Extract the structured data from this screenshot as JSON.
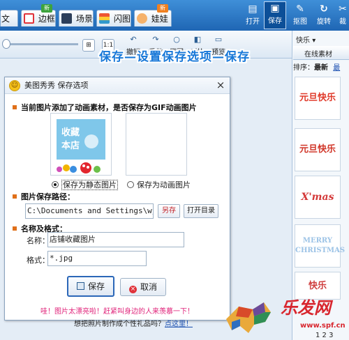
{
  "toolbar": {
    "tabs": [
      {
        "label": "文字",
        "icon": "text-icon"
      },
      {
        "label": "边框",
        "icon": "frame-icon",
        "badge": "新"
      },
      {
        "label": "场景",
        "icon": "scene-icon"
      },
      {
        "label": "闪图",
        "icon": "flash-icon"
      },
      {
        "label": "娃娃",
        "icon": "doll-icon",
        "badge": "新"
      }
    ],
    "buttons": {
      "open": "打开",
      "save": "保存",
      "crop": "抠图",
      "rotate": "旋转",
      "cut": "裁"
    }
  },
  "subtoolbar": {
    "zoom_fit": "⊞",
    "zoom_actual": "1:1",
    "undo": "撤销",
    "redo": "重做",
    "original": "原图",
    "compare": "对比",
    "preview": "预览"
  },
  "annotation": "保存—设置保存选项—保存",
  "right_panel": {
    "category": "快乐",
    "tab_online": "在线素材",
    "sort_label": "排序：",
    "sort_latest": "最新",
    "sort_hot": "最",
    "thumbs": [
      {
        "text": "元旦快乐",
        "color": "#e03a2a"
      },
      {
        "text": "元旦快乐",
        "color": "#d1372a"
      },
      {
        "text": "X'mas",
        "color": "#d43838"
      },
      {
        "text": "MERRY CHRISTMAS",
        "color": "#9cc3e6"
      },
      {
        "text": "快乐",
        "color": "#d04040"
      }
    ],
    "pages": "1 2 3"
  },
  "dialog": {
    "title": "美图秀秀 保存选项",
    "close": "×",
    "notice": "当前图片添加了动画素材，是否保存为GIF动画图片",
    "preview_static_text": "收藏本店",
    "radio_static": "保存为静态图片",
    "radio_anim": "保存为动画图片",
    "path_label": "图片保存路径：",
    "path_value": "C:\\Documents and Settings\\wj\\桌",
    "btn_save_as": "另存",
    "btn_open_dir": "打开目录",
    "name_format_label": "名称及格式：",
    "name_label": "名称：",
    "name_value": "店铺收藏图片",
    "format_label": "格式：",
    "format_value": "*.jpg",
    "btn_save": "保存",
    "btn_cancel": "取消",
    "hint1": "哇！图片太漂亮啦！赶紧叫身边的人来羡慕一下！",
    "hint2_text": "想把照片制作成个性礼品吗？",
    "hint2_link": "点这里！"
  },
  "watermark": {
    "text": "乐发网",
    "url": "www.spf.cn"
  },
  "colors": {
    "toolbar_blue": "#2a74c4",
    "accent_orange": "#e0701a",
    "hint_pink": "#e0237a",
    "annotation_blue": "#1878d8",
    "watermark_red": "#d8262e"
  }
}
